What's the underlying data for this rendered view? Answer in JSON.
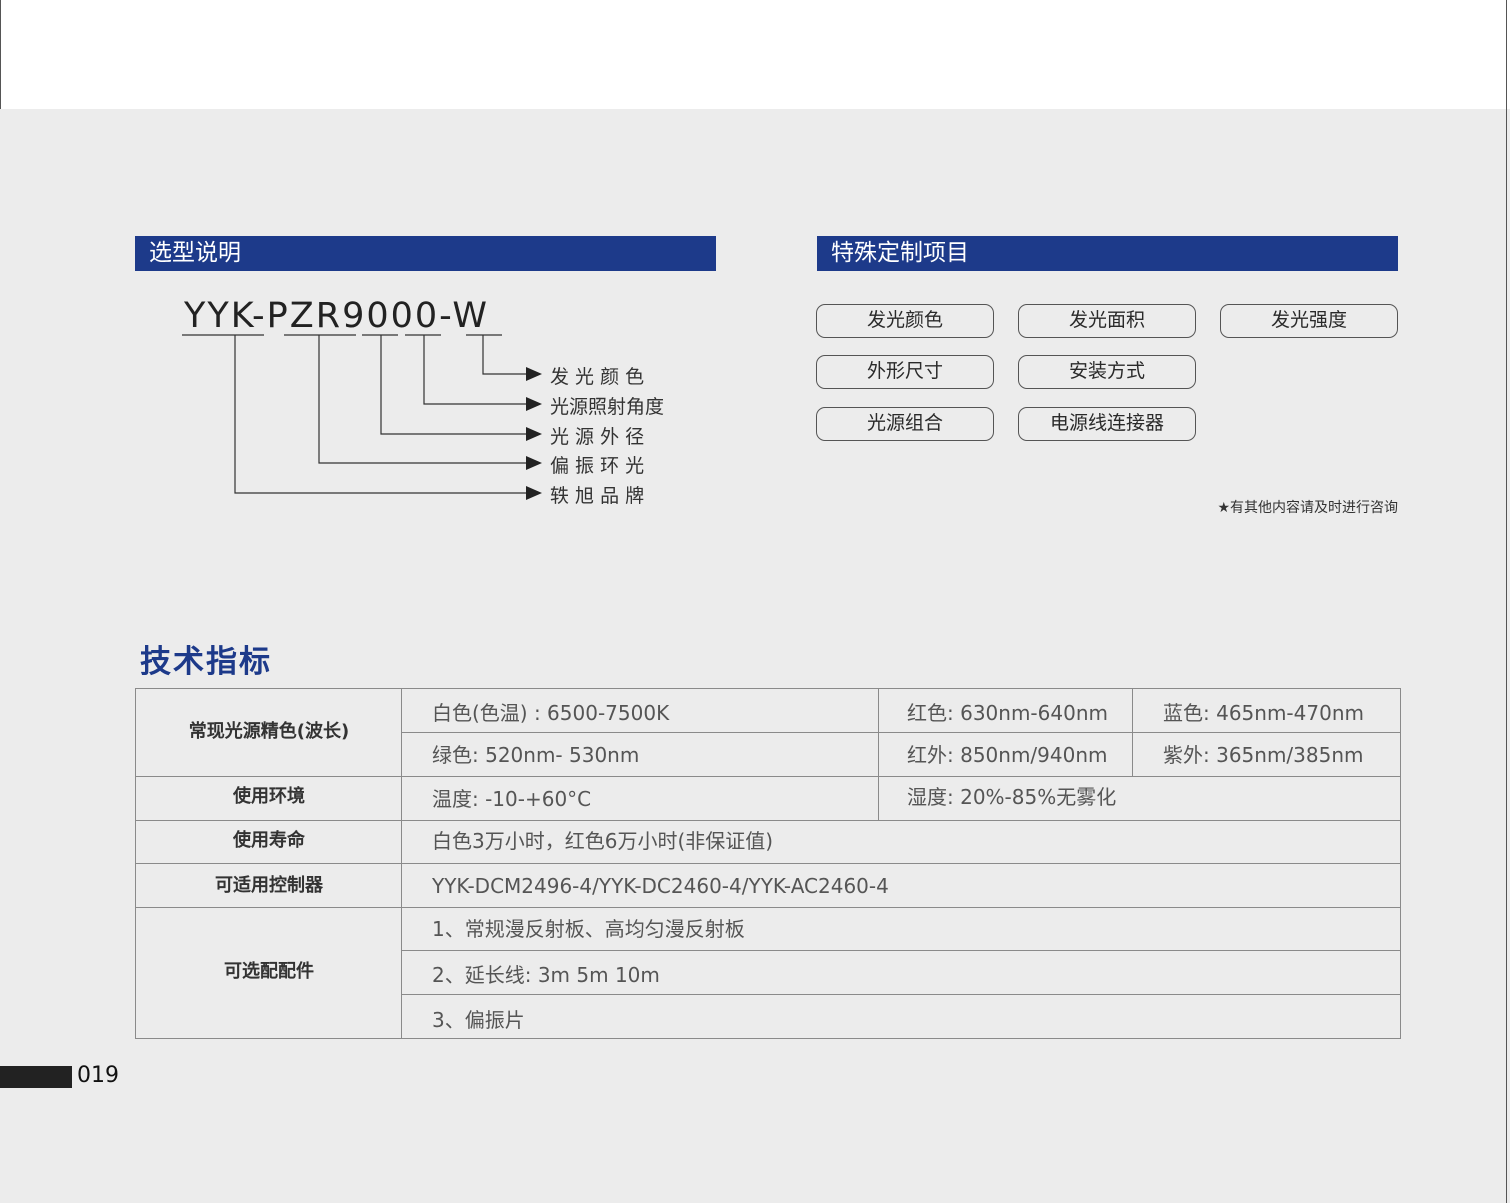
{
  "selection": {
    "title": "选型说明",
    "model_code": "YYK-PZR9000-W",
    "legend": [
      "发 光 颜 色",
      "光源照射角度",
      "光 源 外 径",
      "偏 振 环 光",
      "轶 旭 品 牌"
    ]
  },
  "custom": {
    "title": "特殊定制项目",
    "items": [
      "发光颜色",
      "发光面积",
      "发光强度",
      "外形尺寸",
      "安装方式",
      "光源组合",
      "电源线连接器"
    ],
    "note": "★有其他内容请及时进行咨询"
  },
  "tech": {
    "title": "技术指标",
    "rows": {
      "color": {
        "label": "常现光源精色(波长)",
        "white": "白色(色温) : 6500-7500K",
        "red": "红色: 630nm-640nm",
        "blue": "蓝色: 465nm-470nm",
        "green": "绿色: 520nm- 530nm",
        "ir": "红外: 850nm/940nm",
        "uv": "紫外: 365nm/385nm"
      },
      "env": {
        "label": "使用环境",
        "temp": "温度: -10-+60°C",
        "humidity": "湿度: 20%-85%无雾化"
      },
      "life": {
        "label": "使用寿命",
        "value": "白色3万小时，红色6万小时(非保证值)"
      },
      "controller": {
        "label": "可适用控制器",
        "value": "YYK-DCM2496-4/YYK-DC2460-4/YYK-AC2460-4"
      },
      "accessories": {
        "label": "可选配配件",
        "items": [
          "1、常规漫反射板、高均匀漫反射板",
          "2、延长线: 3m  5m 10m",
          "3、偏振片"
        ]
      }
    }
  },
  "page_number": "019",
  "colors": {
    "accent": "#1d3a8a",
    "background": "#ececec"
  }
}
